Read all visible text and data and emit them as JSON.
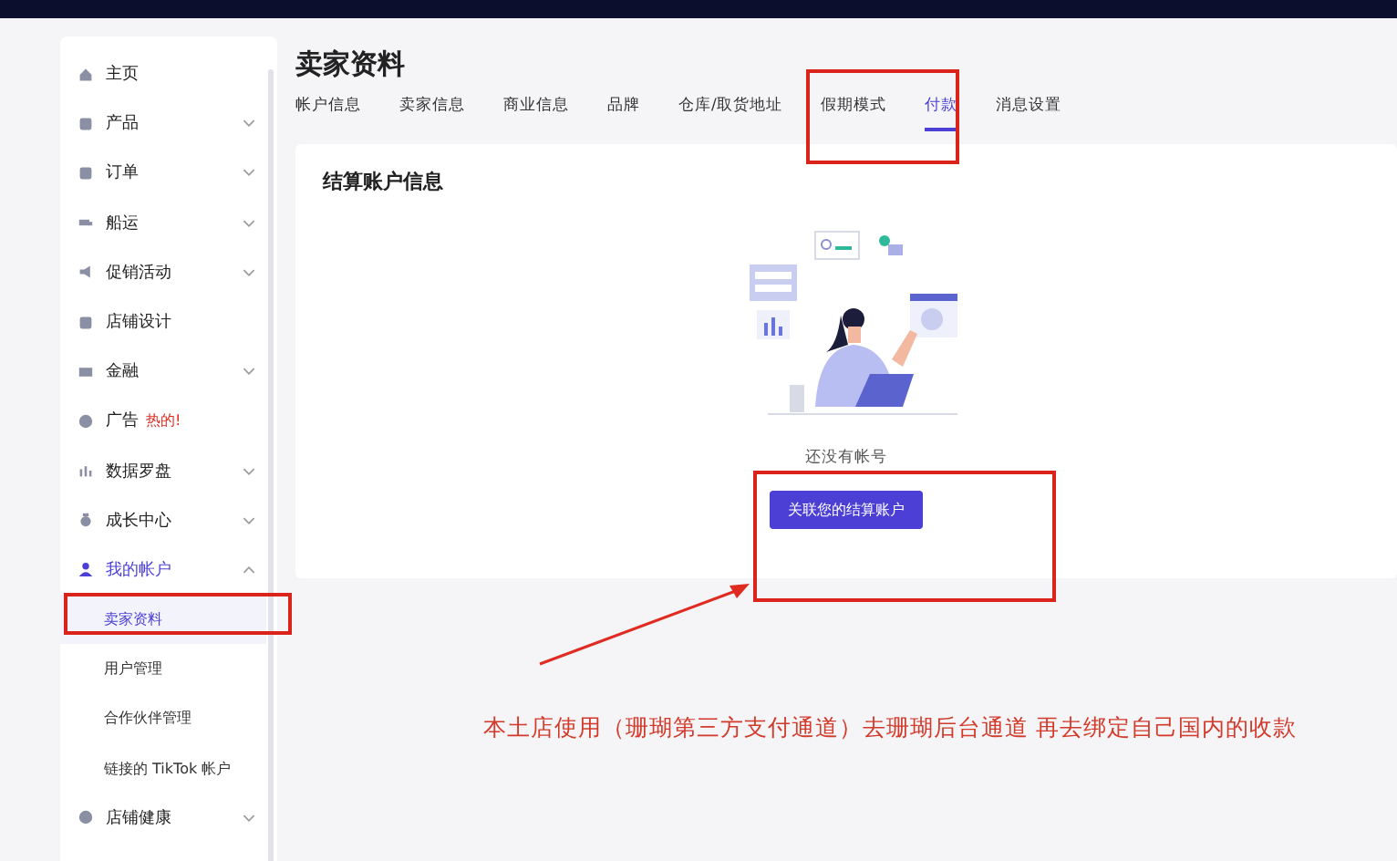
{
  "sidebar": {
    "items": [
      {
        "label": "主页",
        "selected": false
      },
      {
        "label": "产品",
        "expanded": false,
        "selected": false
      },
      {
        "label": "订单",
        "expanded": false,
        "selected": false
      },
      {
        "label": "船运",
        "expanded": false,
        "selected": false
      },
      {
        "label": "促销活动",
        "expanded": false,
        "selected": false
      },
      {
        "label": "店铺设计",
        "selected": false
      },
      {
        "label": "金融",
        "expanded": false,
        "selected": false
      },
      {
        "label": "广告",
        "badge": "热的!",
        "selected": false
      },
      {
        "label": "数据罗盘",
        "expanded": false,
        "selected": false
      },
      {
        "label": "成长中心",
        "expanded": false,
        "selected": false
      },
      {
        "label": "我的帐户",
        "expanded": true,
        "selected": true,
        "children": [
          {
            "label": "卖家资料",
            "selected": true
          },
          {
            "label": "用户管理",
            "selected": false
          },
          {
            "label": "合作伙伴管理",
            "selected": false
          },
          {
            "label": "链接的 TikTok 帐户",
            "selected": false
          }
        ]
      },
      {
        "label": "店铺健康",
        "expanded": false,
        "selected": false
      }
    ]
  },
  "page": {
    "title": "卖家资料"
  },
  "tabs": [
    {
      "label": "帐户信息",
      "selected": false
    },
    {
      "label": "卖家信息",
      "selected": false
    },
    {
      "label": "商业信息",
      "selected": false
    },
    {
      "label": "品牌",
      "selected": false
    },
    {
      "label": "仓库/取货地址",
      "selected": false
    },
    {
      "label": "假期模式",
      "selected": false
    },
    {
      "label": "付款",
      "selected": true
    },
    {
      "label": "消息设置",
      "selected": false
    }
  ],
  "card": {
    "title": "结算账户信息",
    "empty_text": "还没有帐号",
    "button": "关联您的结算账户"
  },
  "annotation": {
    "note": "本土店使用（珊瑚第三方支付通道）去珊瑚后台通道 再去绑定自己国内的收款"
  }
}
